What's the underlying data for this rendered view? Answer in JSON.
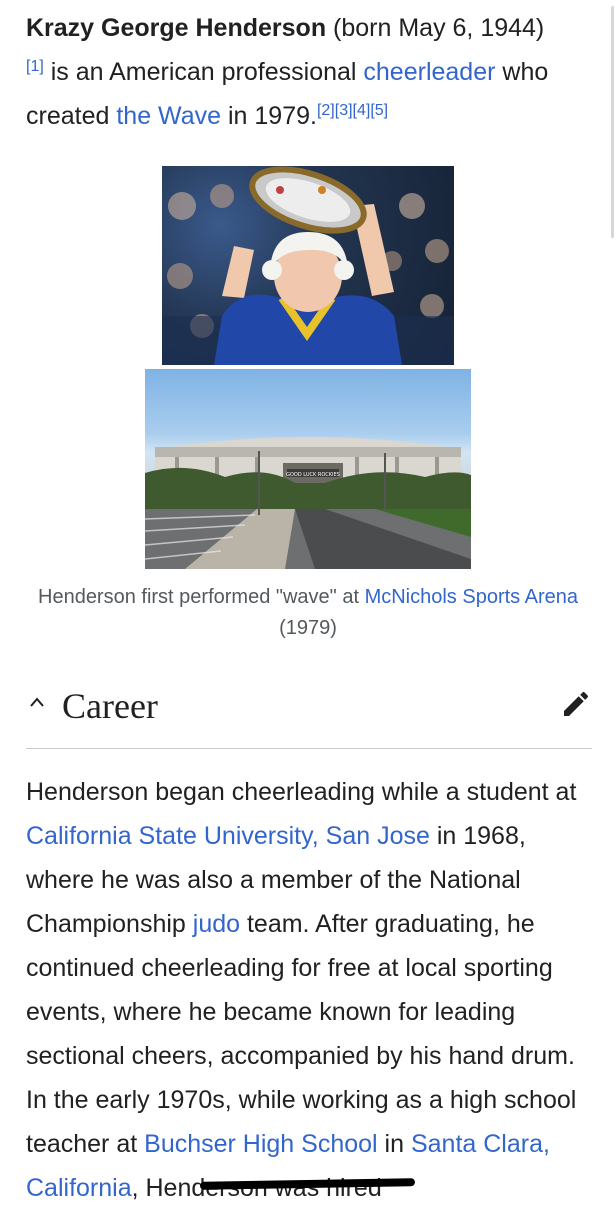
{
  "lead": {
    "subject_name": "Krazy George Henderson",
    "born_text": " (born May 6, 1944)",
    "ref1": "[1]",
    "text_a": " is an American professional ",
    "link_cheerleader": "cheerleader",
    "text_b": " who created ",
    "link_wave": "the Wave",
    "text_c": " in 1979.",
    "refs": "[2][3][4][5]"
  },
  "figure": {
    "caption_text": "Henderson first performed \"wave\" at ",
    "caption_link": "McNichols Sports Arena",
    "caption_tail": " (1979)",
    "arena_sign": "GOOD LUCK ROCKIES"
  },
  "section": {
    "title": "Career"
  },
  "career": {
    "t1": "Henderson began cheerleading while a student at ",
    "link_csu": "California State University, San Jose",
    "t2": " in 1968, where he was also a member of the National Championship ",
    "link_judo": "judo",
    "t3": " team. After graduating, he continued cheerleading for free at local sporting events, where he became known for leading sectional cheers, accompanied by his hand drum. In the early 1970s, while working as a high school teacher at ",
    "link_buchser": "Buchser High School",
    "t4": " in ",
    "link_santa_clara": "Santa Clara, California",
    "t5": ", Henderson was hired"
  },
  "colors": {
    "link": "#3366cc",
    "text": "#202122",
    "caption": "#54595d",
    "divider": "#c8ccd1"
  },
  "icons": {
    "section_toggle": "chevron-up-icon",
    "edit": "pencil-icon"
  }
}
